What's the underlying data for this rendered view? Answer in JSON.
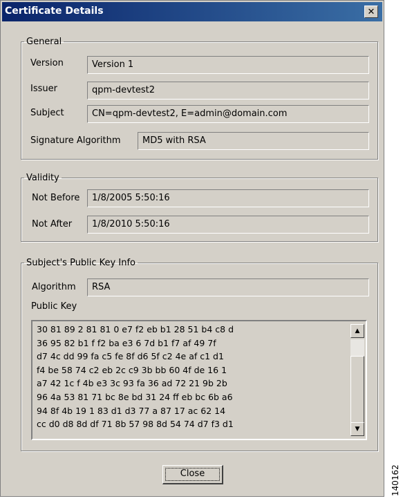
{
  "window": {
    "title": "Certificate Details",
    "close_glyph": "✕"
  },
  "general": {
    "legend": "General",
    "version_label": "Version",
    "version_value": "Version 1",
    "issuer_label": "Issuer",
    "issuer_value": "qpm-devtest2",
    "subject_label": "Subject",
    "subject_value": "CN=qpm-devtest2, E=admin@domain.com",
    "sigalg_label": "Signature Algorithm",
    "sigalg_value": "MD5 with RSA"
  },
  "validity": {
    "legend": "Validity",
    "not_before_label": "Not Before",
    "not_before_value": "1/8/2005 5:50:16",
    "not_after_label": "Not After",
    "not_after_value": "1/8/2010 5:50:16"
  },
  "pubkey": {
    "legend": "Subject's Public Key Info",
    "algorithm_label": "Algorithm",
    "algorithm_value": "RSA",
    "public_key_label": "Public Key",
    "lines": [
      "30 81 89 2 81 81 0 e7 f2 eb b1 28 51 b4 c8 d",
      "36 95 82 b1 f f2 ba e3 6 7d b1 f7 af 49 7f",
      "d7 4c dd 99 fa c5 fe 8f d6 5f c2 4e af c1 d1",
      "f4 be 58 74 c2 eb 2c c9 3b bb 60 4f de 16 1",
      "a7 42 1c f 4b e3 3c 93 fa 36 ad 72 21 9b 2b",
      "96 4a 53 81 71 bc 8e bd 31 24 ff eb bc 6b a6",
      "94 8f 4b 19 1 83 d1 d3 77 a 87 17 ac 62 14",
      "cc d0 d8 8d df 71 8b 57 98 8d 54 74 d7 f3 d1"
    ],
    "scroll_up_glyph": "▲",
    "scroll_down_glyph": "▼"
  },
  "buttons": {
    "close_label": "Close"
  },
  "figure_id": "140162"
}
